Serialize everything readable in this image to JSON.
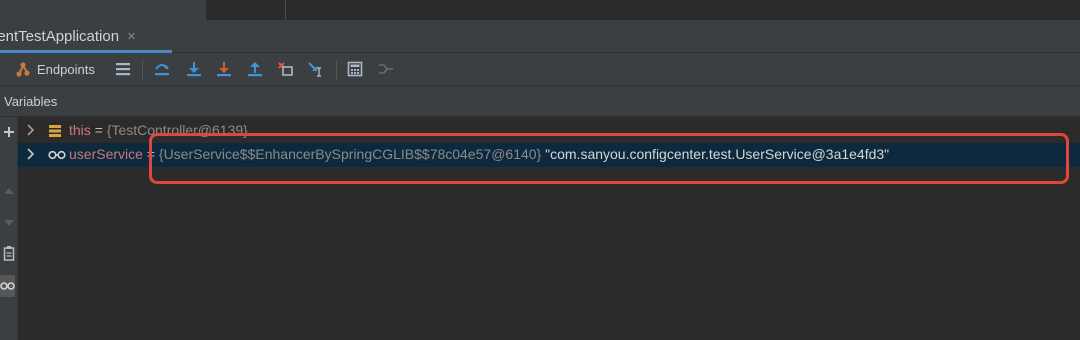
{
  "tab": {
    "title": "ientTestApplication",
    "close_glyph": "×"
  },
  "toolbar": {
    "endpoints_label": "Endpoints",
    "icons": [
      "endpoints-icon",
      "show-execution-point-icon",
      "step-over-icon",
      "step-into-icon",
      "force-step-into-icon",
      "step-out-icon",
      "drop-frame-icon",
      "run-to-cursor-icon",
      "evaluate-expression-icon",
      "trace-current-stream-icon"
    ]
  },
  "variables": {
    "title": "Variables",
    "rows": [
      {
        "name": "this",
        "eq": "=",
        "type": "{TestController@6139}",
        "value": ""
      },
      {
        "name": "userService",
        "eq": "=",
        "type": "{UserService$$EnhancerBySpringCGLIB$$78c04e57@6140}",
        "value": "\"com.sanyou.configcenter.test.UserService@3a1e4fd3\""
      }
    ]
  },
  "colors": {
    "background": "#2b2b2b",
    "panel": "#3c3f41",
    "selection": "#0d293e",
    "var_name": "#ce7878",
    "highlight_box": "#e2463a",
    "accent_blue": "#4a88c7"
  }
}
